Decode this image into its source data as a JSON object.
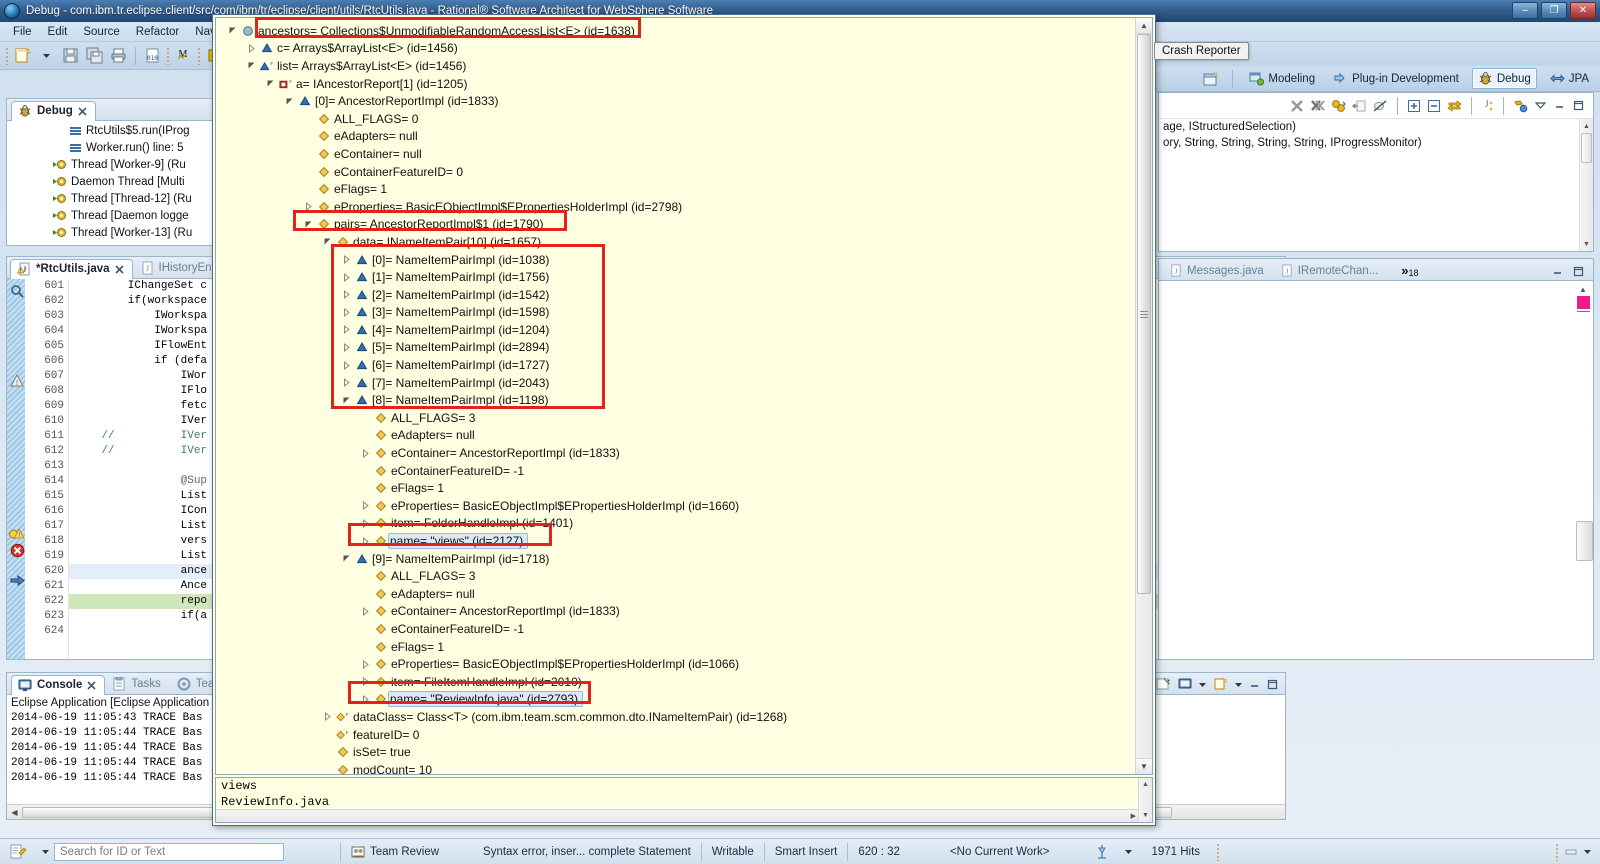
{
  "window": {
    "title": "Debug - com.ibm.tr.eclipse.client/src/com/ibm/tr/eclipse/client/utils/RtcUtils.java - Rational® Software Architect for WebSphere Software",
    "minimize_label": "–",
    "maximize_label": "❐",
    "close_label": "✕"
  },
  "menubar": {
    "items": [
      {
        "label": "File"
      },
      {
        "label": "Edit"
      },
      {
        "label": "Source"
      },
      {
        "label": "Refactor"
      },
      {
        "label": "Naviga"
      }
    ]
  },
  "toolbar": {
    "icons": [
      "new-wizard-icon",
      "new-dropdown-icon",
      "save-icon",
      "save-all-icon",
      "print-icon",
      "toggle-binary-icon",
      "modeling-icon",
      "resume-icon",
      "suspend-icon"
    ]
  },
  "perspective_bar": {
    "open_perspective_label": "",
    "items": [
      {
        "label": "Modeling",
        "icon": "modeling-perspective-icon",
        "active": false
      },
      {
        "label": "Plug-in Development",
        "icon": "plugin-perspective-icon",
        "active": false
      },
      {
        "label": "Debug",
        "icon": "debug-perspective-icon",
        "active": true
      },
      {
        "label": "JPA",
        "icon": "jpa-perspective-icon",
        "active": false
      }
    ]
  },
  "crash_reporter_tooltip": "Crash Reporter",
  "debug_view": {
    "tab_label": "Debug",
    "rows": [
      {
        "indent": 3,
        "icon": "stack-frame-icon",
        "label": "RtcUtils$5.run(IProg"
      },
      {
        "indent": 3,
        "icon": "stack-frame-icon",
        "label": "Worker.run() line: 5"
      },
      {
        "indent": 2,
        "icon": "thread-icon",
        "label": "Thread [Worker-9] (Ru"
      },
      {
        "indent": 2,
        "icon": "thread-icon",
        "label": "Daemon Thread [Multi"
      },
      {
        "indent": 2,
        "icon": "thread-icon",
        "label": "Thread [Thread-12] (Ru"
      },
      {
        "indent": 2,
        "icon": "thread-icon",
        "label": "Thread [Daemon logge"
      },
      {
        "indent": 2,
        "icon": "thread-icon",
        "label": "Thread [Worker-13] (Ru"
      }
    ]
  },
  "editor": {
    "tabs": [
      {
        "label": "*RtcUtils.java",
        "active": true,
        "icon": "java-warning-icon",
        "closeable": true
      },
      {
        "label": "IHistoryEnt...",
        "active": false,
        "icon": "java-icon",
        "closeable": false
      }
    ],
    "first_line_number": 601,
    "lines": [
      {
        "n": 601,
        "annot": "",
        "text": "        IChangeSet c",
        "marker": ""
      },
      {
        "n": 602,
        "annot": "",
        "text": "        if(workspace",
        "marker": ""
      },
      {
        "n": 603,
        "annot": "",
        "text": "            IWorkspa",
        "marker": ""
      },
      {
        "n": 604,
        "annot": "",
        "text": "            IWorkspa",
        "marker": ""
      },
      {
        "n": 605,
        "annot": "",
        "text": "            IFlowEnt",
        "marker": ""
      },
      {
        "n": 606,
        "annot": "",
        "text": "            if (defa",
        "marker": ""
      },
      {
        "n": 607,
        "annot": "warning-icon",
        "text": "                IWor",
        "marker": ""
      },
      {
        "n": 608,
        "annot": "",
        "text": "                IFlo",
        "marker": ""
      },
      {
        "n": 609,
        "annot": "",
        "text": "                fetc",
        "marker": ""
      },
      {
        "n": 610,
        "annot": "",
        "text": "                IVer",
        "marker": ""
      },
      {
        "n": 611,
        "annot": "",
        "text": "    //          IVer",
        "marker": "comment"
      },
      {
        "n": 612,
        "annot": "",
        "text": "    //          IVer",
        "marker": "comment"
      },
      {
        "n": 613,
        "annot": "",
        "text": "",
        "marker": ""
      },
      {
        "n": 614,
        "annot": "",
        "text": "                @Sup",
        "marker": "annotation"
      },
      {
        "n": 615,
        "annot": "",
        "text": "                List",
        "marker": ""
      },
      {
        "n": 616,
        "annot": "",
        "text": "                ICon",
        "marker": ""
      },
      {
        "n": 617,
        "annot": "",
        "text": "                List",
        "marker": ""
      },
      {
        "n": 618,
        "annot": "",
        "text": "                vers",
        "marker": ""
      },
      {
        "n": 619,
        "annot": "quickfix-warning-icon",
        "text": "                List",
        "marker": ""
      },
      {
        "n": 620,
        "annot": "error-icon",
        "text": "                ance",
        "marker": "selected"
      },
      {
        "n": 621,
        "annot": "",
        "text": "                Ance",
        "marker": ""
      },
      {
        "n": 622,
        "annot": "current-instruction-icon",
        "text": "                repo",
        "marker": "executing"
      },
      {
        "n": 623,
        "annot": "",
        "text": "                if(a",
        "marker": ""
      },
      {
        "n": 624,
        "annot": "",
        "text": "",
        "marker": ""
      }
    ]
  },
  "right_editor": {
    "lines": [
      "age, IStructuredSelection)",
      "ory, String, String, String, String, IProgressMonitor)"
    ],
    "toolbar_icons": [
      "remove-terminated-icon",
      "remove-all-icon",
      "preferences-icon",
      "export-icon",
      "disabled-breakpoint-icon",
      "expand-all-icon",
      "collapse-all-icon",
      "link-editor-icon",
      "sort-icon",
      "breakpoint-icon",
      "view-menu-icon",
      "minimize-icon",
      "maximize-icon"
    ],
    "tabs": [
      {
        "label": "Messages.java",
        "active": false,
        "icon": "java-icon"
      },
      {
        "label": "IRemoteChan...",
        "active": false,
        "icon": "java-icon"
      }
    ],
    "overflow_count": "18",
    "overflow_symbol": "»"
  },
  "console_view": {
    "tabs": [
      {
        "label": "Console",
        "active": true,
        "icon": "console-icon"
      },
      {
        "label": "Tasks",
        "active": false,
        "icon": "tasks-icon"
      },
      {
        "label": "Team",
        "active": false,
        "icon": "team-icon"
      }
    ],
    "header": "Eclipse Application [Eclipse Application",
    "lines": [
      "2014-06-19 11:05:43 TRACE Bas",
      "2014-06-19 11:05:44 TRACE Bas",
      "2014-06-19 11:05:44 TRACE Bas",
      "2014-06-19 11:05:44 TRACE Bas",
      "2014-06-19 11:05:44 TRACE Bas"
    ],
    "toolbar_icons": [
      "terminate-icon",
      "remove-launch-icon",
      "remove-all-launches-icon",
      "clear-console-icon",
      "lock-scroll-icon",
      "show-console-icon",
      "show-on-error-icon",
      "open-console-icon",
      "display-selected-console-icon",
      "new-console-view-icon",
      "minimize-icon",
      "maximize-icon"
    ]
  },
  "inspect_dialog": {
    "detail_lines": [
      "views",
      "ReviewInfo.java"
    ],
    "tree": [
      {
        "indent": 0,
        "arrow": "expanded",
        "icon": "object-icon",
        "label": "ancestors= Collections$UnmodifiableRandomAccessList<E>  (id=1638)",
        "highlighted": true
      },
      {
        "indent": 1,
        "arrow": "collapsed",
        "icon": "field-blue-icon",
        "label": "c= Arrays$ArrayList<E>  (id=1456)"
      },
      {
        "indent": 1,
        "arrow": "expanded",
        "icon": "field-blue-f-icon",
        "label": "list= Arrays$ArrayList<E>  (id=1456)"
      },
      {
        "indent": 2,
        "arrow": "expanded",
        "icon": "field-red-f-icon",
        "label": "a= IAncestorReport[1]  (id=1205)"
      },
      {
        "indent": 3,
        "arrow": "expanded",
        "icon": "field-blue-icon",
        "label": "[0]= AncestorReportImpl  (id=1833)"
      },
      {
        "indent": 4,
        "arrow": "none",
        "icon": "field-yellow-icon",
        "label": "ALL_FLAGS= 0"
      },
      {
        "indent": 4,
        "arrow": "none",
        "icon": "field-yellow-icon",
        "label": "eAdapters= null"
      },
      {
        "indent": 4,
        "arrow": "none",
        "icon": "field-yellow-icon",
        "label": "eContainer= null"
      },
      {
        "indent": 4,
        "arrow": "none",
        "icon": "field-yellow-icon",
        "label": "eContainerFeatureID= 0"
      },
      {
        "indent": 4,
        "arrow": "none",
        "icon": "field-yellow-icon",
        "label": "eFlags= 1"
      },
      {
        "indent": 4,
        "arrow": "collapsed",
        "icon": "field-yellow-icon",
        "label": "eProperties= BasicEObjectImpl$EPropertiesHolderImpl  (id=2798)"
      },
      {
        "indent": 4,
        "arrow": "expanded",
        "icon": "field-yellow-icon",
        "label": "pairs= AncestorReportImpl$1  (id=1790)",
        "highlighted": true
      },
      {
        "indent": 5,
        "arrow": "expanded",
        "icon": "field-yellow-icon",
        "label": "data= INameItemPair[10]  (id=1657)"
      },
      {
        "indent": 6,
        "arrow": "collapsed",
        "icon": "field-blue-icon",
        "label": "[0]= NameItemPairImpl  (id=1038)"
      },
      {
        "indent": 6,
        "arrow": "collapsed",
        "icon": "field-blue-icon",
        "label": "[1]= NameItemPairImpl  (id=1756)"
      },
      {
        "indent": 6,
        "arrow": "collapsed",
        "icon": "field-blue-icon",
        "label": "[2]= NameItemPairImpl  (id=1542)"
      },
      {
        "indent": 6,
        "arrow": "collapsed",
        "icon": "field-blue-icon",
        "label": "[3]= NameItemPairImpl  (id=1598)"
      },
      {
        "indent": 6,
        "arrow": "collapsed",
        "icon": "field-blue-icon",
        "label": "[4]= NameItemPairImpl  (id=1204)"
      },
      {
        "indent": 6,
        "arrow": "collapsed",
        "icon": "field-blue-icon",
        "label": "[5]= NameItemPairImpl  (id=2894)"
      },
      {
        "indent": 6,
        "arrow": "collapsed",
        "icon": "field-blue-icon",
        "label": "[6]= NameItemPairImpl  (id=1727)"
      },
      {
        "indent": 6,
        "arrow": "collapsed",
        "icon": "field-blue-icon",
        "label": "[7]= NameItemPairImpl  (id=2043)"
      },
      {
        "indent": 6,
        "arrow": "expanded",
        "icon": "field-blue-icon",
        "label": "[8]= NameItemPairImpl  (id=1198)"
      },
      {
        "indent": 7,
        "arrow": "none",
        "icon": "field-yellow-icon",
        "label": "ALL_FLAGS= 3"
      },
      {
        "indent": 7,
        "arrow": "none",
        "icon": "field-yellow-icon",
        "label": "eAdapters= null"
      },
      {
        "indent": 7,
        "arrow": "collapsed",
        "icon": "field-yellow-icon",
        "label": "eContainer= AncestorReportImpl  (id=1833)"
      },
      {
        "indent": 7,
        "arrow": "none",
        "icon": "field-yellow-icon",
        "label": "eContainerFeatureID= -1"
      },
      {
        "indent": 7,
        "arrow": "none",
        "icon": "field-yellow-icon",
        "label": "eFlags= 1"
      },
      {
        "indent": 7,
        "arrow": "collapsed",
        "icon": "field-yellow-icon",
        "label": "eProperties= BasicEObjectImpl$EPropertiesHolderImpl  (id=1660)"
      },
      {
        "indent": 7,
        "arrow": "collapsed",
        "icon": "field-yellow-icon",
        "label": "item= FolderHandleImpl  (id=1401)"
      },
      {
        "indent": 7,
        "arrow": "collapsed",
        "icon": "field-yellow-icon",
        "label": "name= \"views\" (id=2127)",
        "selected": true,
        "highlighted": true
      },
      {
        "indent": 6,
        "arrow": "expanded",
        "icon": "field-blue-icon",
        "label": "[9]= NameItemPairImpl  (id=1718)"
      },
      {
        "indent": 7,
        "arrow": "none",
        "icon": "field-yellow-icon",
        "label": "ALL_FLAGS= 3"
      },
      {
        "indent": 7,
        "arrow": "none",
        "icon": "field-yellow-icon",
        "label": "eAdapters= null"
      },
      {
        "indent": 7,
        "arrow": "collapsed",
        "icon": "field-yellow-icon",
        "label": "eContainer= AncestorReportImpl  (id=1833)"
      },
      {
        "indent": 7,
        "arrow": "none",
        "icon": "field-yellow-icon",
        "label": "eContainerFeatureID= -1"
      },
      {
        "indent": 7,
        "arrow": "none",
        "icon": "field-yellow-icon",
        "label": "eFlags= 1"
      },
      {
        "indent": 7,
        "arrow": "collapsed",
        "icon": "field-yellow-icon",
        "label": "eProperties= BasicEObjectImpl$EPropertiesHolderImpl  (id=1066)"
      },
      {
        "indent": 7,
        "arrow": "collapsed",
        "icon": "field-yellow-icon",
        "label": "item= FileItemHandleImpl  (id=2010)"
      },
      {
        "indent": 7,
        "arrow": "collapsed",
        "icon": "field-yellow-icon",
        "label": "name= \"ReviewInfo.java\" (id=2793)",
        "selected": true,
        "highlighted": true
      },
      {
        "indent": 5,
        "arrow": "collapsed",
        "icon": "field-yellow-f-icon",
        "label": "dataClass= Class<T> (com.ibm.team.scm.common.dto.INameItemPair) (id=1268)"
      },
      {
        "indent": 5,
        "arrow": "none",
        "icon": "field-yellow-f-icon",
        "label": "featureID= 0"
      },
      {
        "indent": 5,
        "arrow": "none",
        "icon": "field-yellow-icon",
        "label": "isSet= true"
      },
      {
        "indent": 5,
        "arrow": "none",
        "icon": "field-yellow-icon",
        "label": "modCount= 10"
      }
    ]
  },
  "statusbar": {
    "search_placeholder": "Search for ID or Text",
    "team_review_label": "Team Review",
    "syntax_message": "Syntax error, inser... complete Statement",
    "writable": "Writable",
    "insert_mode": "Smart Insert",
    "position": "620 : 32",
    "current_work": "<No Current Work>",
    "hits": "1971 Hits"
  },
  "colors": {
    "accent_blue": "#3d6f9e",
    "dialog_bg": "#ffffe1",
    "annotation_red": "#e2231a",
    "selection_blue": "#dbe8f7",
    "exec_line_green": "#cfe7b9"
  }
}
